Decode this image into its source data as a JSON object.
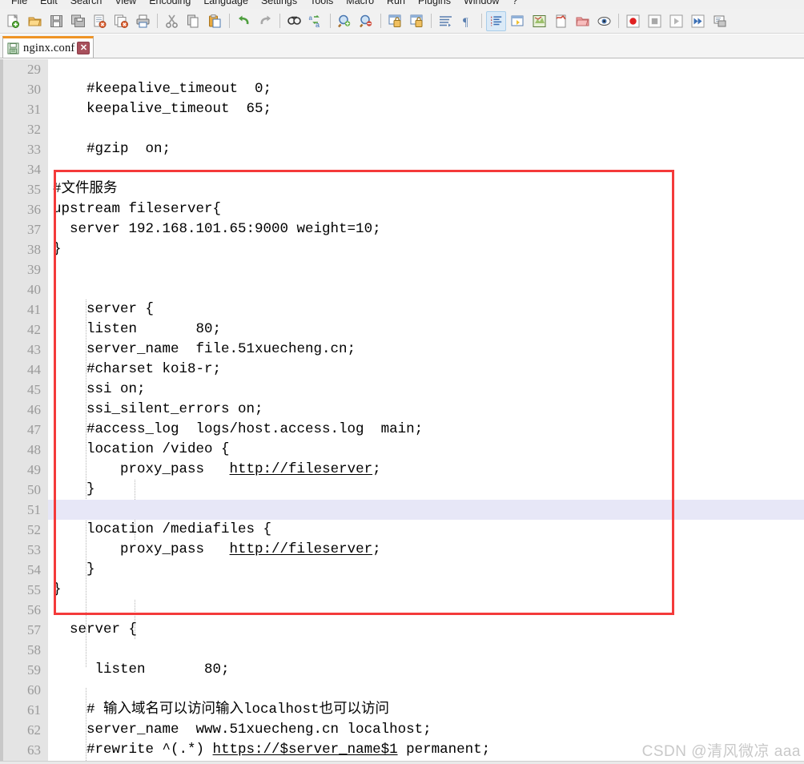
{
  "app": {
    "name": "Notepad++",
    "accent_orange": "#ef9425",
    "annotation_color": "#f43a3a",
    "current_line_highlight": "#e7e7f7",
    "gutter_bg": "#e4e4e4"
  },
  "menubar": {
    "items": [
      {
        "label": "File",
        "name": "menu-file"
      },
      {
        "label": "Edit",
        "name": "menu-edit"
      },
      {
        "label": "Search",
        "name": "menu-search"
      },
      {
        "label": "View",
        "name": "menu-view"
      },
      {
        "label": "Encoding",
        "name": "menu-encoding"
      },
      {
        "label": "Language",
        "name": "menu-language"
      },
      {
        "label": "Settings",
        "name": "menu-settings"
      },
      {
        "label": "Tools",
        "name": "menu-tools"
      },
      {
        "label": "Macro",
        "name": "menu-macro"
      },
      {
        "label": "Run",
        "name": "menu-run"
      },
      {
        "label": "Plugins",
        "name": "menu-plugins"
      },
      {
        "label": "Window",
        "name": "menu-window"
      },
      {
        "label": "?",
        "name": "menu-help"
      }
    ]
  },
  "toolbar": {
    "buttons": [
      {
        "icon": "new-file-icon",
        "group": 1
      },
      {
        "icon": "open-folder-icon",
        "group": 1
      },
      {
        "icon": "save-icon",
        "group": 1
      },
      {
        "icon": "save-all-icon",
        "group": 1
      },
      {
        "icon": "close-file-icon",
        "group": 1
      },
      {
        "icon": "close-all-files-icon",
        "group": 1
      },
      {
        "icon": "print-icon",
        "group": 1
      },
      {
        "icon": "cut-icon",
        "group": 2
      },
      {
        "icon": "copy-icon",
        "group": 2
      },
      {
        "icon": "paste-icon",
        "group": 2
      },
      {
        "icon": "undo-icon",
        "group": 3
      },
      {
        "icon": "redo-icon",
        "group": 3
      },
      {
        "icon": "find-icon",
        "group": 4
      },
      {
        "icon": "replace-icon",
        "group": 4
      },
      {
        "icon": "zoom-in-icon",
        "group": 5
      },
      {
        "icon": "zoom-out-icon",
        "group": 5
      },
      {
        "icon": "sync-vertical-scroll-icon",
        "group": 6
      },
      {
        "icon": "sync-horizontal-scroll-icon",
        "group": 6
      },
      {
        "icon": "word-wrap-icon",
        "group": 7
      },
      {
        "icon": "show-all-characters-icon",
        "group": 7
      },
      {
        "icon": "indent-guide-icon",
        "group": 8,
        "active": true
      },
      {
        "icon": "user-defined-language-icon",
        "group": 8
      },
      {
        "icon": "document-map-icon",
        "group": 8
      },
      {
        "icon": "function-list-icon",
        "group": 8
      },
      {
        "icon": "folder-as-workspace-icon",
        "group": 8
      },
      {
        "icon": "monitoring-icon",
        "group": 8
      },
      {
        "icon": "record-macro-icon",
        "group": 9
      },
      {
        "icon": "stop-recording-icon",
        "group": 9
      },
      {
        "icon": "play-macro-icon",
        "group": 9
      },
      {
        "icon": "run-macro-multiple-icon",
        "group": 9
      },
      {
        "icon": "run-icon",
        "group": 9
      }
    ]
  },
  "tabs": [
    {
      "label": "nginx.conf",
      "icon": "saved-document-icon",
      "close_glyph": "✕",
      "active": true
    }
  ],
  "editor": {
    "first_line": 29,
    "highlighted_line": 51,
    "line_numbers": [
      29,
      30,
      31,
      32,
      33,
      34,
      35,
      36,
      37,
      38,
      39,
      40,
      41,
      42,
      43,
      44,
      45,
      46,
      47,
      48,
      49,
      50,
      51,
      52,
      53,
      54,
      55,
      56,
      57,
      58,
      59,
      60,
      61,
      62,
      63
    ],
    "lines": [
      {
        "n": 29,
        "text": ""
      },
      {
        "n": 30,
        "text": "    #keepalive_timeout  0;"
      },
      {
        "n": 31,
        "text": "    keepalive_timeout  65;"
      },
      {
        "n": 32,
        "text": ""
      },
      {
        "n": 33,
        "text": "    #gzip  on;"
      },
      {
        "n": 34,
        "text": ""
      },
      {
        "n": 35,
        "text": "#文件服务"
      },
      {
        "n": 36,
        "text": "upstream fileserver{"
      },
      {
        "n": 37,
        "text": "  server 192.168.101.65:9000 weight=10;"
      },
      {
        "n": 38,
        "text": "}"
      },
      {
        "n": 39,
        "text": ""
      },
      {
        "n": 40,
        "text": ""
      },
      {
        "n": 41,
        "text": "    server {"
      },
      {
        "n": 42,
        "text": "    listen       80;"
      },
      {
        "n": 43,
        "text": "    server_name  file.51xuecheng.cn;"
      },
      {
        "n": 44,
        "text": "    #charset koi8-r;"
      },
      {
        "n": 45,
        "text": "    ssi on;"
      },
      {
        "n": 46,
        "text": "    ssi_silent_errors on;"
      },
      {
        "n": 47,
        "text": "    #access_log  logs/host.access.log  main;"
      },
      {
        "n": 48,
        "text": "    location /video {"
      },
      {
        "n": 49,
        "text": "        proxy_pass   ",
        "link": "http://fileserver",
        "tail": ";"
      },
      {
        "n": 50,
        "text": "    }"
      },
      {
        "n": 51,
        "text": ""
      },
      {
        "n": 52,
        "text": "    location /mediafiles {"
      },
      {
        "n": 53,
        "text": "        proxy_pass   ",
        "link": "http://fileserver",
        "tail": ";"
      },
      {
        "n": 54,
        "text": "    }"
      },
      {
        "n": 55,
        "text": "}"
      },
      {
        "n": 56,
        "text": ""
      },
      {
        "n": 57,
        "text": "  server {"
      },
      {
        "n": 58,
        "text": ""
      },
      {
        "n": 59,
        "text": "     listen       80;"
      },
      {
        "n": 60,
        "text": ""
      },
      {
        "n": 61,
        "text": "    # 输入域名可以访问输入localhost也可以访问"
      },
      {
        "n": 62,
        "text": "    server_name  www.51xuecheng.cn localhost;"
      },
      {
        "n": 63,
        "text": "    #rewrite ^(.*) ",
        "link": "https://$server_name$1",
        "tail": " permanent;"
      }
    ]
  },
  "annotation": {
    "shape": "rectangle",
    "covers_lines": "35-56"
  },
  "watermark": {
    "text": "CSDN @清风微凉 aaa"
  }
}
